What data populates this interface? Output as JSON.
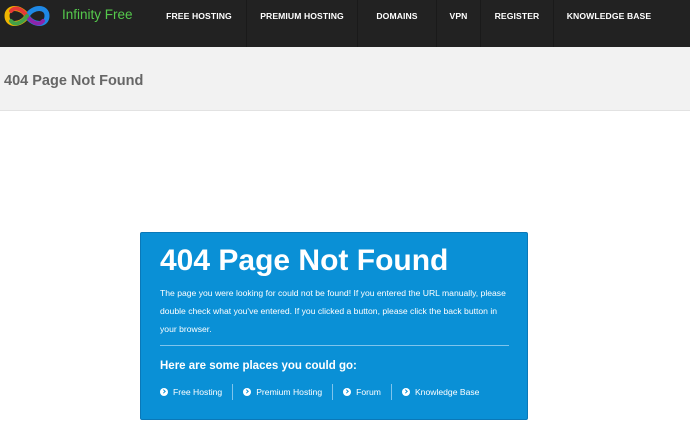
{
  "brand": {
    "name": "Infinity Free"
  },
  "nav": {
    "items": [
      {
        "label": "FREE HOSTING"
      },
      {
        "label": "PREMIUM HOSTING"
      },
      {
        "label": "DOMAINS"
      },
      {
        "label": "VPN"
      },
      {
        "label": "REGISTER"
      },
      {
        "label": "KNOWLEDGE BASE"
      }
    ]
  },
  "page": {
    "title": "404 Page Not Found"
  },
  "error": {
    "heading": "404 Page Not Found",
    "description": "The page you were looking for could not be found! If you entered the URL manually, please double check what you've entered. If you clicked a button, please click the back button in your browser.",
    "places_heading": "Here are some places you could go:",
    "links": [
      {
        "label": "Free Hosting"
      },
      {
        "label": "Premium Hosting"
      },
      {
        "label": "Forum"
      },
      {
        "label": "Knowledge Base"
      }
    ]
  },
  "colors": {
    "topbar": "#222222",
    "brand_green": "#55c94c",
    "title_band": "#f2f2f2",
    "error_box": "#0a90d6"
  }
}
